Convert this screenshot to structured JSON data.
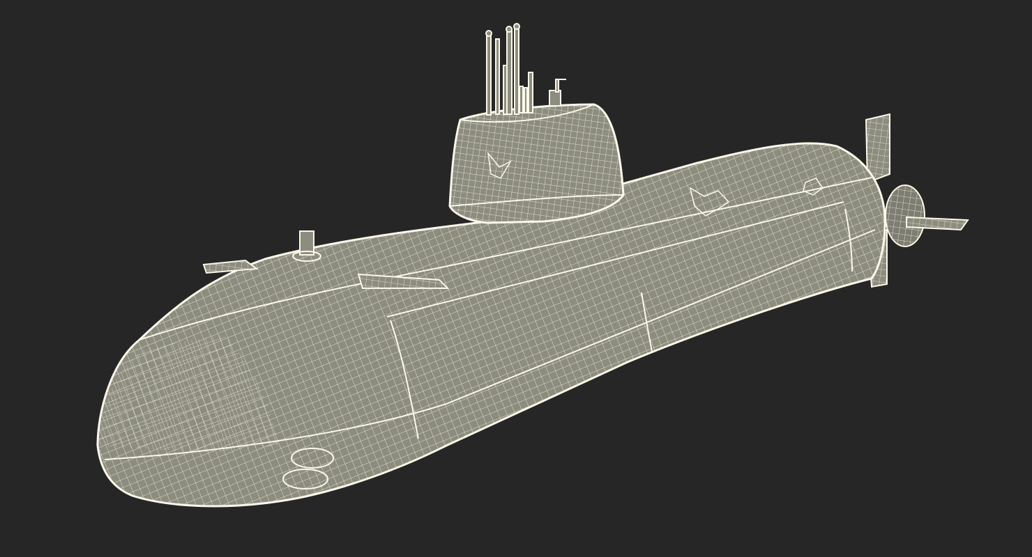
{
  "scene": {
    "subject": "submarine-wireframe-model",
    "colors": {
      "background": "#262626",
      "hull_fill": "#8c8c7f",
      "hull_fill_dark": "#6f6f65",
      "wire": "#f2efe0",
      "edge": "#fbf8ea"
    }
  }
}
